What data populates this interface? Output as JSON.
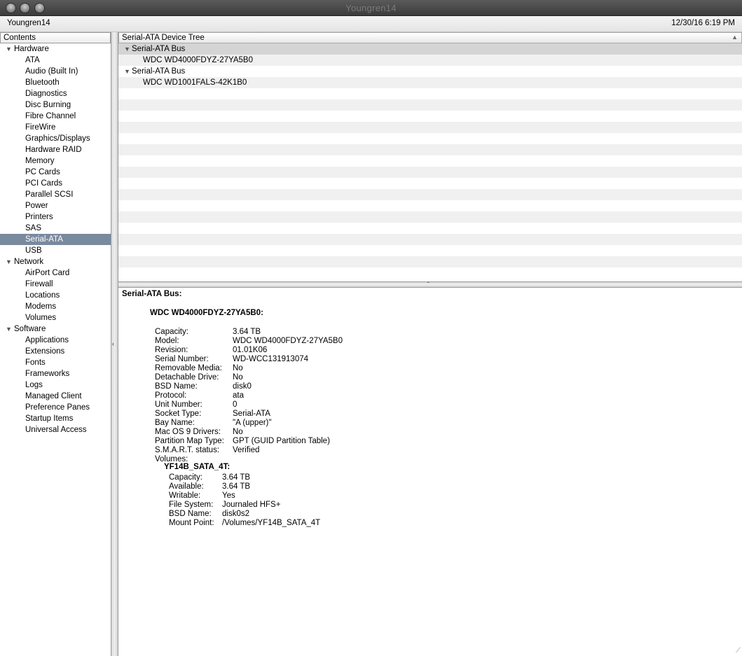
{
  "window": {
    "title": "Youngren14"
  },
  "infobar": {
    "machine_name": "Youngren14",
    "datetime": "12/30/16 6:19 PM"
  },
  "sidebar": {
    "header": "Contents",
    "groups": [
      {
        "label": "Hardware",
        "items": [
          "ATA",
          "Audio (Built In)",
          "Bluetooth",
          "Diagnostics",
          "Disc Burning",
          "Fibre Channel",
          "FireWire",
          "Graphics/Displays",
          "Hardware RAID",
          "Memory",
          "PC Cards",
          "PCI Cards",
          "Parallel SCSI",
          "Power",
          "Printers",
          "SAS",
          "Serial-ATA",
          "USB"
        ]
      },
      {
        "label": "Network",
        "items": [
          "AirPort Card",
          "Firewall",
          "Locations",
          "Modems",
          "Volumes"
        ]
      },
      {
        "label": "Software",
        "items": [
          "Applications",
          "Extensions",
          "Fonts",
          "Frameworks",
          "Logs",
          "Managed Client",
          "Preference Panes",
          "Startup Items",
          "Universal Access"
        ]
      }
    ],
    "selected": "Serial-ATA"
  },
  "device_tree": {
    "header": "Serial-ATA Device Tree",
    "buses": [
      {
        "label": "Serial-ATA Bus",
        "device": "WDC WD4000FDYZ-27YA5B0"
      },
      {
        "label": "Serial-ATA Bus",
        "device": "WDC WD1001FALS-42K1B0"
      }
    ]
  },
  "detail": {
    "heading": "Serial-ATA Bus:",
    "device_title": "WDC WD4000FDYZ-27YA5B0:",
    "properties": [
      {
        "key": "Capacity:",
        "value": "3.64 TB"
      },
      {
        "key": "Model:",
        "value": "WDC WD4000FDYZ-27YA5B0"
      },
      {
        "key": "Revision:",
        "value": "01.01K06"
      },
      {
        "key": "Serial Number:",
        "value": "WD-WCC131913074"
      },
      {
        "key": "Removable Media:",
        "value": "No"
      },
      {
        "key": "Detachable Drive:",
        "value": "No"
      },
      {
        "key": "BSD Name:",
        "value": "disk0"
      },
      {
        "key": "Protocol:",
        "value": "ata"
      },
      {
        "key": "Unit Number:",
        "value": "0"
      },
      {
        "key": "Socket Type:",
        "value": "Serial-ATA"
      },
      {
        "key": "Bay Name:",
        "value": "\"A (upper)\""
      },
      {
        "key": "Mac OS 9 Drivers:",
        "value": "No"
      },
      {
        "key": "Partition Map Type:",
        "value": "GPT (GUID Partition Table)"
      },
      {
        "key": "S.M.A.R.T. status:",
        "value": "Verified"
      },
      {
        "key": "Volumes:",
        "value": ""
      }
    ],
    "volume_name": "YF14B_SATA_4T:",
    "volume_properties": [
      {
        "key": "Capacity:",
        "value": "3.64 TB"
      },
      {
        "key": "Available:",
        "value": "3.64 TB"
      },
      {
        "key": "Writable:",
        "value": "Yes"
      },
      {
        "key": "File System:",
        "value": "Journaled HFS+"
      },
      {
        "key": "BSD Name:",
        "value": "disk0s2"
      },
      {
        "key": "Mount Point:",
        "value": "/Volumes/YF14B_SATA_4T"
      }
    ]
  },
  "colors": {
    "selection": "#7a8a9e",
    "titlebar": "#3c3c3c"
  }
}
